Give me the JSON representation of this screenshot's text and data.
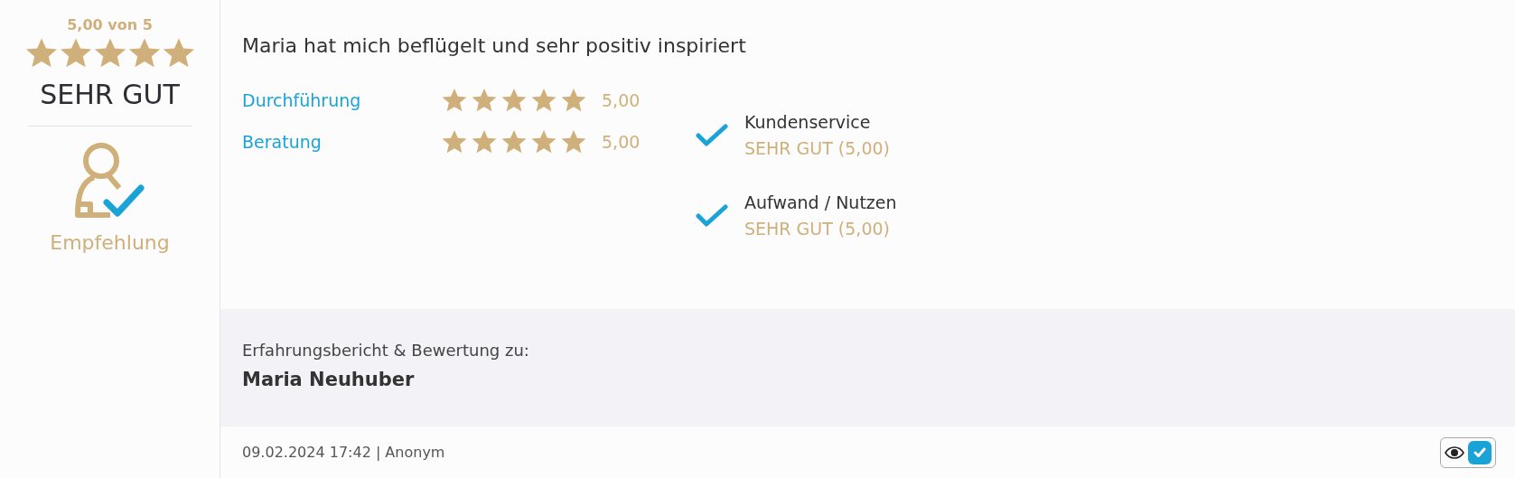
{
  "summary": {
    "score_text": "5,00 von 5",
    "stars": 5,
    "verdict": "SEHR GUT",
    "recommendation": "Empfehlung"
  },
  "review": {
    "title": "Maria hat mich beflügelt und sehr positiv inspiriert",
    "ratings": [
      {
        "label": "Durchführung",
        "stars": 5,
        "value": "5,00"
      },
      {
        "label": "Beratung",
        "stars": 5,
        "value": "5,00"
      }
    ],
    "checks": [
      {
        "label": "Kundenservice",
        "verdict": "SEHR GUT (5,00)"
      },
      {
        "label": "Aufwand / Nutzen",
        "verdict": "SEHR GUT (5,00)"
      }
    ]
  },
  "subject": {
    "caption": "Erfahrungsbericht & Bewertung zu:",
    "name": "Maria Neuhuber"
  },
  "footer": {
    "meta": "09.02.2024 17:42 | Anonym",
    "approved": true
  }
}
